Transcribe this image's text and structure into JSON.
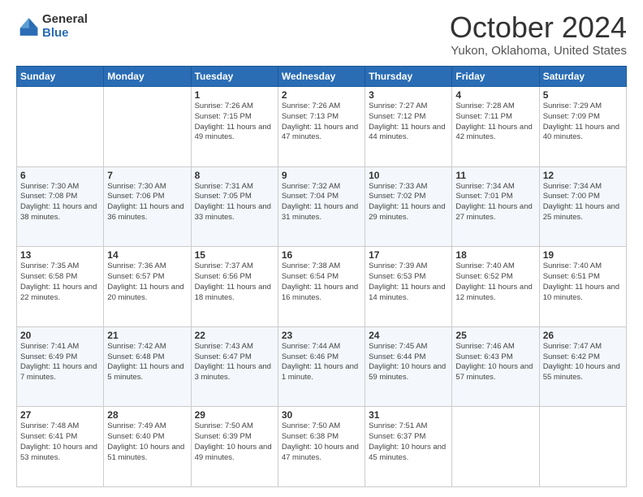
{
  "header": {
    "logo_general": "General",
    "logo_blue": "Blue",
    "title": "October 2024",
    "location": "Yukon, Oklahoma, United States"
  },
  "days_of_week": [
    "Sunday",
    "Monday",
    "Tuesday",
    "Wednesday",
    "Thursday",
    "Friday",
    "Saturday"
  ],
  "weeks": [
    [
      {
        "day": "",
        "info": ""
      },
      {
        "day": "",
        "info": ""
      },
      {
        "day": "1",
        "info": "Sunrise: 7:26 AM\nSunset: 7:15 PM\nDaylight: 11 hours and 49 minutes."
      },
      {
        "day": "2",
        "info": "Sunrise: 7:26 AM\nSunset: 7:13 PM\nDaylight: 11 hours and 47 minutes."
      },
      {
        "day": "3",
        "info": "Sunrise: 7:27 AM\nSunset: 7:12 PM\nDaylight: 11 hours and 44 minutes."
      },
      {
        "day": "4",
        "info": "Sunrise: 7:28 AM\nSunset: 7:11 PM\nDaylight: 11 hours and 42 minutes."
      },
      {
        "day": "5",
        "info": "Sunrise: 7:29 AM\nSunset: 7:09 PM\nDaylight: 11 hours and 40 minutes."
      }
    ],
    [
      {
        "day": "6",
        "info": "Sunrise: 7:30 AM\nSunset: 7:08 PM\nDaylight: 11 hours and 38 minutes."
      },
      {
        "day": "7",
        "info": "Sunrise: 7:30 AM\nSunset: 7:06 PM\nDaylight: 11 hours and 36 minutes."
      },
      {
        "day": "8",
        "info": "Sunrise: 7:31 AM\nSunset: 7:05 PM\nDaylight: 11 hours and 33 minutes."
      },
      {
        "day": "9",
        "info": "Sunrise: 7:32 AM\nSunset: 7:04 PM\nDaylight: 11 hours and 31 minutes."
      },
      {
        "day": "10",
        "info": "Sunrise: 7:33 AM\nSunset: 7:02 PM\nDaylight: 11 hours and 29 minutes."
      },
      {
        "day": "11",
        "info": "Sunrise: 7:34 AM\nSunset: 7:01 PM\nDaylight: 11 hours and 27 minutes."
      },
      {
        "day": "12",
        "info": "Sunrise: 7:34 AM\nSunset: 7:00 PM\nDaylight: 11 hours and 25 minutes."
      }
    ],
    [
      {
        "day": "13",
        "info": "Sunrise: 7:35 AM\nSunset: 6:58 PM\nDaylight: 11 hours and 22 minutes."
      },
      {
        "day": "14",
        "info": "Sunrise: 7:36 AM\nSunset: 6:57 PM\nDaylight: 11 hours and 20 minutes."
      },
      {
        "day": "15",
        "info": "Sunrise: 7:37 AM\nSunset: 6:56 PM\nDaylight: 11 hours and 18 minutes."
      },
      {
        "day": "16",
        "info": "Sunrise: 7:38 AM\nSunset: 6:54 PM\nDaylight: 11 hours and 16 minutes."
      },
      {
        "day": "17",
        "info": "Sunrise: 7:39 AM\nSunset: 6:53 PM\nDaylight: 11 hours and 14 minutes."
      },
      {
        "day": "18",
        "info": "Sunrise: 7:40 AM\nSunset: 6:52 PM\nDaylight: 11 hours and 12 minutes."
      },
      {
        "day": "19",
        "info": "Sunrise: 7:40 AM\nSunset: 6:51 PM\nDaylight: 11 hours and 10 minutes."
      }
    ],
    [
      {
        "day": "20",
        "info": "Sunrise: 7:41 AM\nSunset: 6:49 PM\nDaylight: 11 hours and 7 minutes."
      },
      {
        "day": "21",
        "info": "Sunrise: 7:42 AM\nSunset: 6:48 PM\nDaylight: 11 hours and 5 minutes."
      },
      {
        "day": "22",
        "info": "Sunrise: 7:43 AM\nSunset: 6:47 PM\nDaylight: 11 hours and 3 minutes."
      },
      {
        "day": "23",
        "info": "Sunrise: 7:44 AM\nSunset: 6:46 PM\nDaylight: 11 hours and 1 minute."
      },
      {
        "day": "24",
        "info": "Sunrise: 7:45 AM\nSunset: 6:44 PM\nDaylight: 10 hours and 59 minutes."
      },
      {
        "day": "25",
        "info": "Sunrise: 7:46 AM\nSunset: 6:43 PM\nDaylight: 10 hours and 57 minutes."
      },
      {
        "day": "26",
        "info": "Sunrise: 7:47 AM\nSunset: 6:42 PM\nDaylight: 10 hours and 55 minutes."
      }
    ],
    [
      {
        "day": "27",
        "info": "Sunrise: 7:48 AM\nSunset: 6:41 PM\nDaylight: 10 hours and 53 minutes."
      },
      {
        "day": "28",
        "info": "Sunrise: 7:49 AM\nSunset: 6:40 PM\nDaylight: 10 hours and 51 minutes."
      },
      {
        "day": "29",
        "info": "Sunrise: 7:50 AM\nSunset: 6:39 PM\nDaylight: 10 hours and 49 minutes."
      },
      {
        "day": "30",
        "info": "Sunrise: 7:50 AM\nSunset: 6:38 PM\nDaylight: 10 hours and 47 minutes."
      },
      {
        "day": "31",
        "info": "Sunrise: 7:51 AM\nSunset: 6:37 PM\nDaylight: 10 hours and 45 minutes."
      },
      {
        "day": "",
        "info": ""
      },
      {
        "day": "",
        "info": ""
      }
    ]
  ]
}
